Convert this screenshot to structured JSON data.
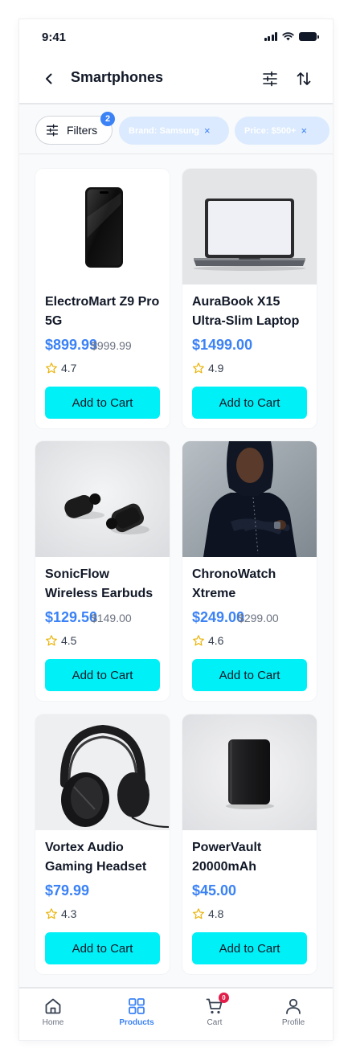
{
  "status_bar": {
    "time": "9:41"
  },
  "header": {
    "title": "Smartphones"
  },
  "filters": {
    "label": "Filters",
    "count": "2",
    "chips": [
      {
        "label": "Brand: Samsung",
        "remove": "×"
      },
      {
        "label": "Price: $500+",
        "remove": "×"
      }
    ]
  },
  "products": [
    {
      "name": "ElectroMart Z9 Pro 5G",
      "price": "$899.99",
      "old_price": "$999.99",
      "rating": "4.7",
      "button": "Add to Cart"
    },
    {
      "name": "AuraBook X15 Ultra-Slim Laptop",
      "price": "$1499.00",
      "old_price": "",
      "rating": "4.9",
      "button": "Add to Cart"
    },
    {
      "name": "SonicFlow Wireless Earbuds",
      "price": "$129.50",
      "old_price": "$149.00",
      "rating": "4.5",
      "button": "Add to Cart"
    },
    {
      "name": "ChronoWatch Xtreme",
      "price": "$249.00",
      "old_price": "$299.00",
      "rating": "4.6",
      "button": "Add to Cart"
    },
    {
      "name": "Vortex Audio Gaming Headset",
      "price": "$79.99",
      "old_price": "",
      "rating": "4.3",
      "button": "Add to Cart"
    },
    {
      "name": "PowerVault 20000mAh",
      "price": "$45.00",
      "old_price": "",
      "rating": "4.8",
      "button": "Add to Cart"
    }
  ],
  "nav": {
    "items": [
      {
        "label": "Home",
        "icon": "home-icon"
      },
      {
        "label": "Products",
        "icon": "grid-icon",
        "active": true
      },
      {
        "label": "Cart",
        "icon": "cart-icon",
        "badge": "0"
      },
      {
        "label": "Profile",
        "icon": "user-icon"
      }
    ]
  },
  "colors": {
    "accent": "#3b82f6",
    "button": "#00f0f7",
    "badge": "#e11d48",
    "chip_bg": "#dbeafe"
  }
}
